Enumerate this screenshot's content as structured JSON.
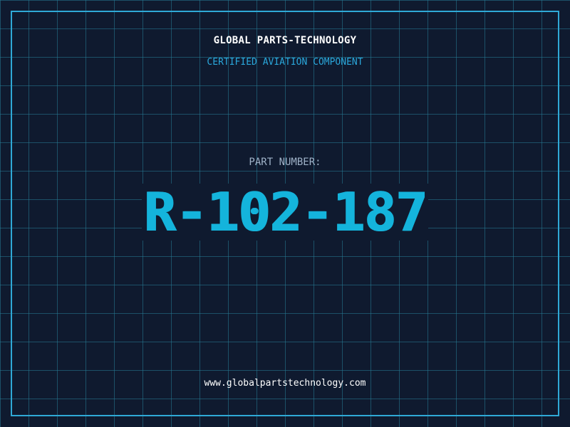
{
  "header": {
    "brand": "GLOBAL PARTS-TECHNOLOGY",
    "subtitle": "CERTIFIED AVIATION COMPONENT"
  },
  "part": {
    "label": "PART NUMBER:",
    "number": "R-102-187"
  },
  "footer": {
    "url": "www.globalpartstechnology.com"
  },
  "colors": {
    "background": "#0f1a2f",
    "grid": "#267c96",
    "frame": "#2fa9d6",
    "accent": "#14b4dc",
    "label": "#9fb2c8",
    "text": "#ffffff"
  }
}
